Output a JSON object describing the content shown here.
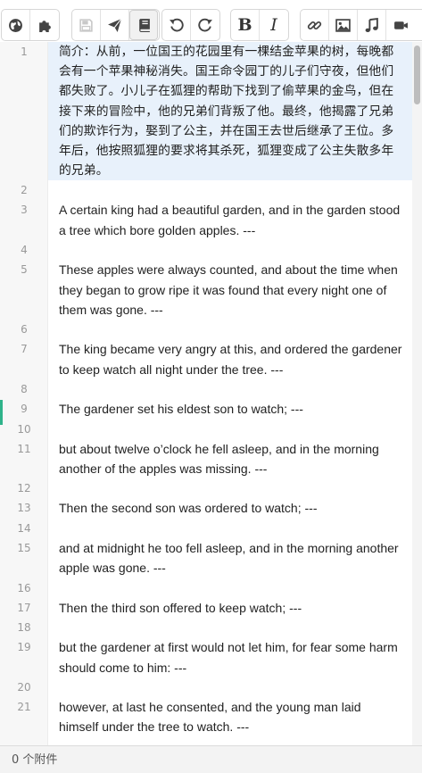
{
  "toolbar": {
    "groups": [
      {
        "buttons": [
          {
            "icon": "globe-icon"
          },
          {
            "icon": "puzzle-icon"
          }
        ]
      },
      {
        "buttons": [
          {
            "icon": "save-icon",
            "state": "disabled"
          },
          {
            "icon": "send-icon"
          },
          {
            "icon": "book-icon",
            "state": "active"
          }
        ]
      },
      {
        "buttons": [
          {
            "icon": "undo-icon"
          },
          {
            "icon": "redo-icon"
          }
        ]
      },
      {
        "buttons": [
          {
            "label": "B"
          },
          {
            "label": "I"
          }
        ]
      },
      {
        "buttons": [
          {
            "icon": "link-icon"
          },
          {
            "icon": "image-icon"
          },
          {
            "icon": "music-icon"
          },
          {
            "icon": "video-icon"
          }
        ]
      }
    ],
    "bold_label": "B",
    "italic_label": "I"
  },
  "editor": {
    "lines": [
      {
        "n": "1",
        "text": "简介：从前，一位国王的花园里有一棵结金苹果的树，每晚都会有一个苹果神秘消失。国王命令园丁的儿子们守夜，但他们都失败了。小儿子在狐狸的帮助下找到了偷苹果的金鸟，但在接下来的冒险中，他的兄弟们背叛了他。最终，他揭露了兄弟们的欺诈行为，娶到了公主，并在国王去世后继承了王位。多年后，他按照狐狸的要求将其杀死，狐狸变成了公主失散多年的兄弟。"
      },
      {
        "n": "2",
        "text": ""
      },
      {
        "n": "3",
        "text": "A certain king had a beautiful garden, and in the garden stood a tree which bore golden apples. ---"
      },
      {
        "n": "4",
        "text": ""
      },
      {
        "n": "5",
        "text": "These apples were always counted, and about the time when they began to grow ripe it was found that every night one of them was gone. ---"
      },
      {
        "n": "6",
        "text": ""
      },
      {
        "n": "7",
        "text": "The king became very angry at this, and ordered the gardener to keep watch all night under the tree. ---"
      },
      {
        "n": "8",
        "text": ""
      },
      {
        "n": "9",
        "text": "The gardener set his eldest son to watch; ---"
      },
      {
        "n": "10",
        "text": ""
      },
      {
        "n": "11",
        "text": "but about twelve o’clock he fell asleep, and in the morning another of the apples was missing. ---"
      },
      {
        "n": "12",
        "text": ""
      },
      {
        "n": "13",
        "text": "Then the second son was ordered to watch; ---"
      },
      {
        "n": "14",
        "text": ""
      },
      {
        "n": "15",
        "text": "and at midnight he too fell asleep, and in the morning another apple was gone. ---"
      },
      {
        "n": "16",
        "text": ""
      },
      {
        "n": "17",
        "text": "Then the third son offered to keep watch; ---"
      },
      {
        "n": "18",
        "text": ""
      },
      {
        "n": "19",
        "text": "but the gardener at first would not let him, for fear some harm should come to him: ---"
      },
      {
        "n": "20",
        "text": ""
      },
      {
        "n": "21",
        "text": "however, at last he consented, and the young man laid himself under the tree to watch. ---"
      }
    ]
  },
  "status": {
    "attachments": "0 个附件"
  },
  "colors": {
    "highlight": "#e8f1fb",
    "change_marker": "#2fb38a"
  }
}
